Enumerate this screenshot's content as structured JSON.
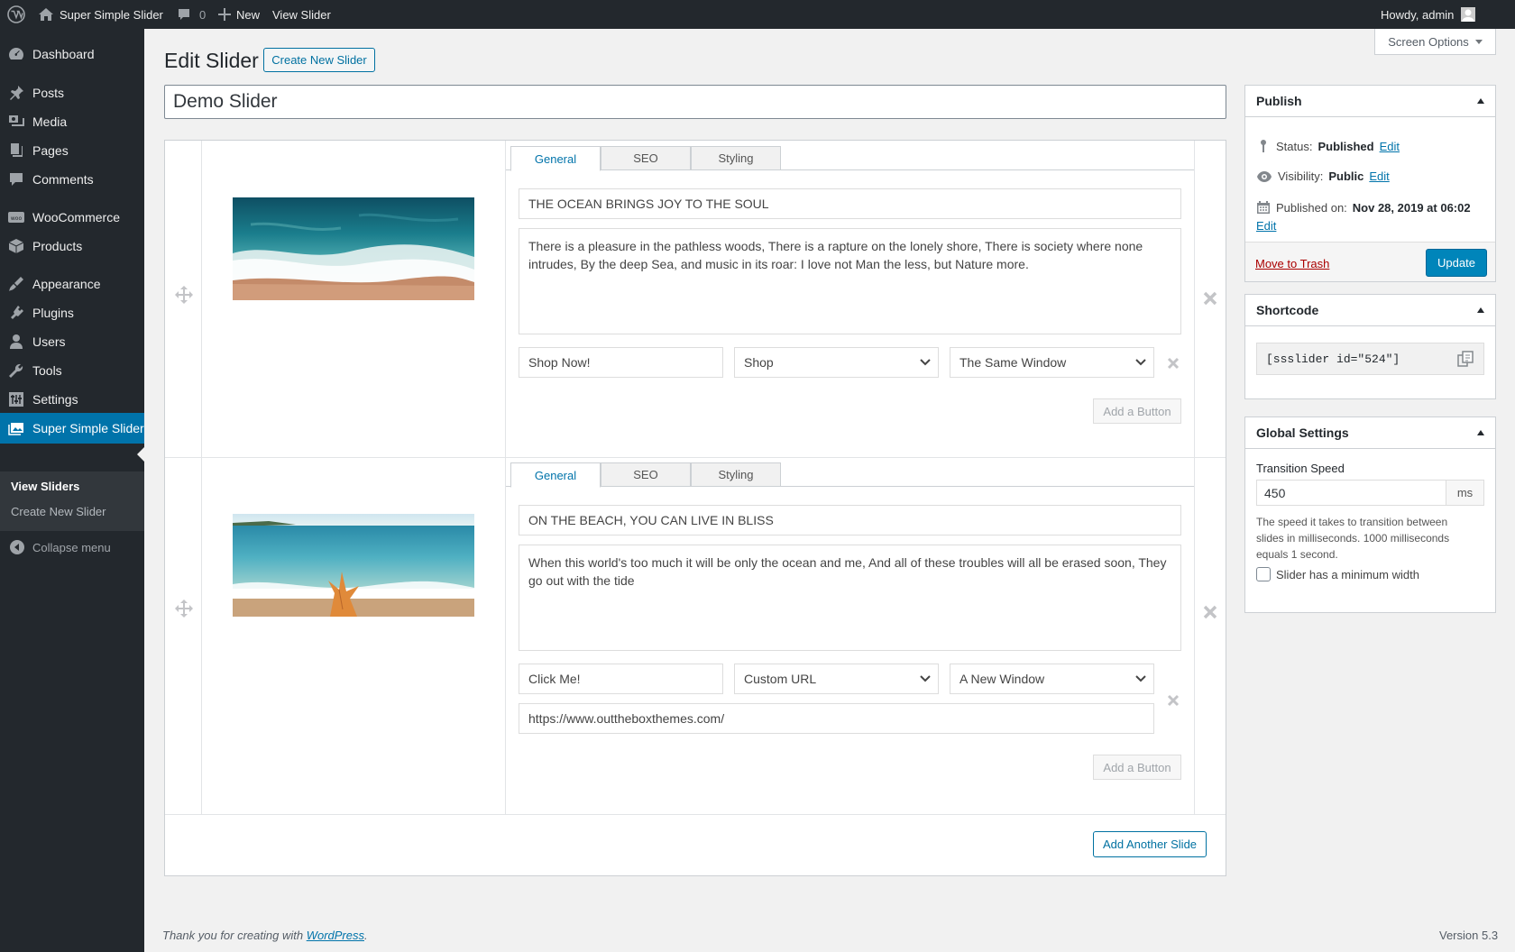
{
  "admin_bar": {
    "site_name": "Super Simple Slider",
    "comments_count": "0",
    "new_label": "New",
    "view_label": "View Slider",
    "howdy": "Howdy, admin"
  },
  "sidebar": {
    "items": [
      {
        "label": "Dashboard",
        "icon": "dashboard-icon"
      },
      {
        "label": "Posts",
        "icon": "pin-icon"
      },
      {
        "label": "Media",
        "icon": "media-icon"
      },
      {
        "label": "Pages",
        "icon": "pages-icon"
      },
      {
        "label": "Comments",
        "icon": "comments-icon"
      },
      {
        "label": "WooCommerce",
        "icon": "woocommerce-icon"
      },
      {
        "label": "Products",
        "icon": "products-icon"
      },
      {
        "label": "Appearance",
        "icon": "appearance-icon"
      },
      {
        "label": "Plugins",
        "icon": "plugins-icon"
      },
      {
        "label": "Users",
        "icon": "users-icon"
      },
      {
        "label": "Tools",
        "icon": "tools-icon"
      },
      {
        "label": "Settings",
        "icon": "settings-icon"
      },
      {
        "label": "Super Simple Slider",
        "icon": "slider-icon"
      }
    ],
    "submenu": [
      "View Sliders",
      "Create New Slider"
    ],
    "collapse": "Collapse menu"
  },
  "page": {
    "title": "Edit Slider",
    "create_new": "Create New Slider",
    "screen_options": "Screen Options",
    "slider_title": "Demo Slider"
  },
  "tabs": [
    "General",
    "SEO",
    "Styling"
  ],
  "slides": [
    {
      "heading": "THE OCEAN BRINGS JOY TO THE SOUL",
      "text": "There is a pleasure in the pathless woods, There is a rapture on the lonely shore, There is society where none intrudes, By the deep Sea, and music in its roar: I love not Man the less, but Nature more.",
      "button_text": "Shop Now!",
      "link_type": "Shop",
      "target": "The Same Window",
      "add_button": "Add a Button"
    },
    {
      "heading": "ON THE BEACH, YOU CAN LIVE IN BLISS",
      "text": "When this world's too much it will be only the ocean and me, And all of these troubles will all be erased soon, They go out with the tide",
      "button_text": "Click Me!",
      "link_type": "Custom URL",
      "target": "A New Window",
      "url": "https://www.outtheboxthemes.com/",
      "add_button": "Add a Button"
    }
  ],
  "add_another_slide": "Add Another Slide",
  "publish": {
    "title": "Publish",
    "status_label": "Status:",
    "status_value": "Published",
    "visibility_label": "Visibility:",
    "visibility_value": "Public",
    "published_label": "Published on:",
    "published_value": "Nov 28, 2019 at 06:02",
    "edit": "Edit",
    "trash": "Move to Trash",
    "update": "Update"
  },
  "shortcode": {
    "title": "Shortcode",
    "value": "[ssslider id=\"524\"]"
  },
  "global_settings": {
    "title": "Global Settings",
    "speed_label": "Transition Speed",
    "speed_value": "450",
    "speed_unit": "ms",
    "description": "The speed it takes to transition between slides in milliseconds. 1000 milliseconds equals 1 second.",
    "min_width_label": "Slider has a minimum width",
    "min_width_checked": false
  },
  "footer": {
    "thanks": "Thank you for creating with",
    "wp_link": "WordPress",
    "version": "Version 5.3"
  },
  "colors": {
    "admin_bg": "#23282d",
    "accent": "#0073aa",
    "trash": "#a00"
  }
}
